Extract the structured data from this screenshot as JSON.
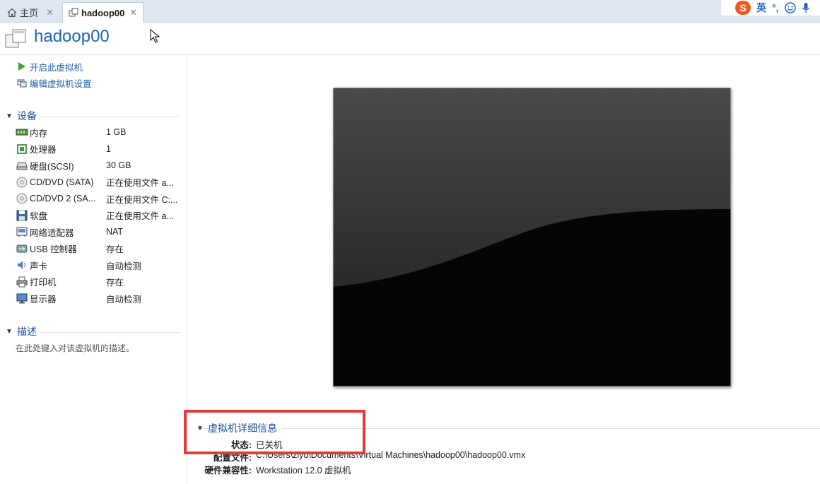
{
  "tabs": [
    {
      "label": "主页",
      "icon": "home-icon"
    },
    {
      "label": "hadoop00",
      "icon": "vm-icon"
    }
  ],
  "ime": {
    "mode": "英",
    "symbols": "°,"
  },
  "vm": {
    "name": "hadoop00"
  },
  "actions": [
    {
      "label": "开启此虚拟机",
      "icon": "play-icon"
    },
    {
      "label": "编辑虚拟机设置",
      "icon": "settings-icon"
    }
  ],
  "devices_section": {
    "title": "设备"
  },
  "devices": [
    {
      "name": "内存",
      "value": "1 GB",
      "icon": "memory-icon"
    },
    {
      "name": "处理器",
      "value": "1",
      "icon": "cpu-icon"
    },
    {
      "name": "硬盘(SCSI)",
      "value": "30 GB",
      "icon": "harddisk-icon"
    },
    {
      "name": "CD/DVD (SATA)",
      "value": "正在使用文件 a...",
      "icon": "cd-icon"
    },
    {
      "name": "CD/DVD 2 (SA...",
      "value": "正在使用文件 C:...",
      "icon": "cd-icon"
    },
    {
      "name": "软盘",
      "value": "正在使用文件 a...",
      "icon": "floppy-icon"
    },
    {
      "name": "网络适配器",
      "value": "NAT",
      "icon": "network-icon"
    },
    {
      "name": "USB 控制器",
      "value": "存在",
      "icon": "usb-icon"
    },
    {
      "name": "声卡",
      "value": "自动检测",
      "icon": "sound-icon"
    },
    {
      "name": "打印机",
      "value": "存在",
      "icon": "printer-icon"
    },
    {
      "name": "显示器",
      "value": "自动检测",
      "icon": "display-icon"
    }
  ],
  "description_section": {
    "title": "描述",
    "placeholder": "在此处键入对该虚拟机的描述。"
  },
  "details": {
    "title": "虚拟机详细信息",
    "rows": [
      {
        "key": "状态:",
        "value": "已关机"
      },
      {
        "key": "配置文件:",
        "value": "C:\\Users\\ziyu\\Documents\\Virtual Machines\\hadoop00\\hadoop00.vmx"
      },
      {
        "key": "硬件兼容性:",
        "value": "Workstation 12.0 虚拟机"
      }
    ]
  }
}
